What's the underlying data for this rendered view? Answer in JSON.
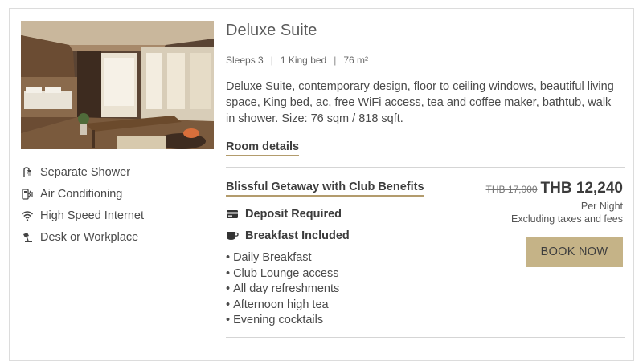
{
  "room": {
    "title": "Deluxe Suite",
    "specs": [
      "Sleeps 3",
      "1 King bed",
      "76 m²"
    ],
    "description": "Deluxe Suite, contemporary design, floor to ceiling windows, beautiful living space, King bed, ac, free WiFi access, tea and coffee maker, bathtub, walk in shower. Size: 76 sqm / 818 sqft.",
    "details_link": "Room details"
  },
  "amenities": [
    {
      "icon": "shower-icon",
      "label": "Separate Shower"
    },
    {
      "icon": "air-conditioning-icon",
      "label": "Air Conditioning"
    },
    {
      "icon": "wifi-icon",
      "label": "High Speed Internet"
    },
    {
      "icon": "desk-lamp-icon",
      "label": "Desk or Workplace"
    }
  ],
  "offer": {
    "name": "Blissful Getaway with Club Benefits",
    "inclusions": [
      {
        "icon": "credit-card-icon",
        "label": "Deposit Required"
      },
      {
        "icon": "coffee-cup-icon",
        "label": "Breakfast Included"
      }
    ],
    "benefits": [
      "Daily Breakfast",
      "Club Lounge access",
      "All day refreshments",
      "Afternoon high tea",
      "Evening cocktails"
    ],
    "old_price": "THB 17,000",
    "price": "THB 12,240",
    "per_night": "Per Night",
    "tax_note": "Excluding taxes and fees",
    "book_label": "BOOK NOW"
  },
  "colors": {
    "accent": "#b39c6d",
    "button": "#c5b387",
    "text": "#4a4a4a"
  }
}
